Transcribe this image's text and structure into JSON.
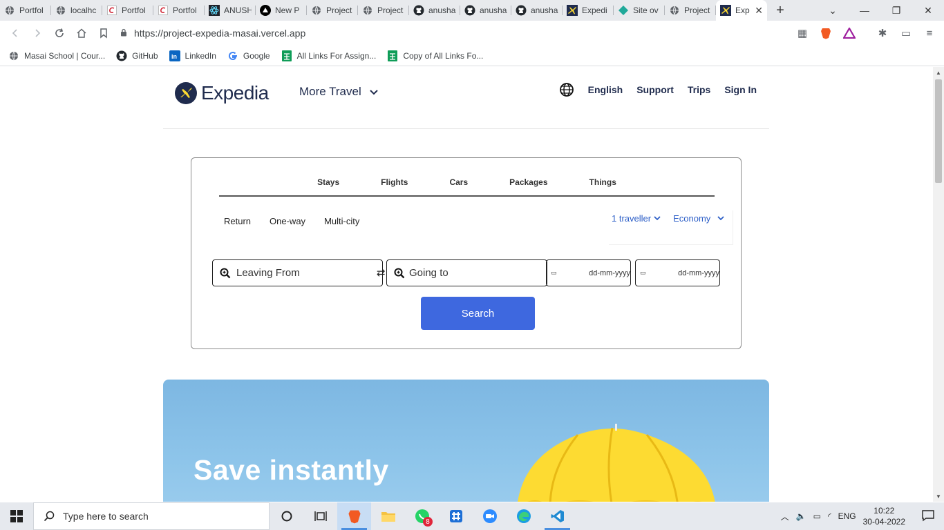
{
  "browser": {
    "tabs": [
      {
        "label": "Portfol",
        "icon": "globe-icon"
      },
      {
        "label": "localhc",
        "icon": "globe-icon"
      },
      {
        "label": "Portfol",
        "icon": "c-logo-icon"
      },
      {
        "label": "Portfol",
        "icon": "c-logo-icon"
      },
      {
        "label": "ANUSH",
        "icon": "react-icon"
      },
      {
        "label": "New P",
        "icon": "vercel-icon"
      },
      {
        "label": "Project",
        "icon": "globe-icon"
      },
      {
        "label": "Project",
        "icon": "globe-icon"
      },
      {
        "label": "anusha",
        "icon": "github-icon"
      },
      {
        "label": "anusha",
        "icon": "github-icon"
      },
      {
        "label": "anusha",
        "icon": "github-icon"
      },
      {
        "label": "Expedi",
        "icon": "expedia-icon"
      },
      {
        "label": "Site ov",
        "icon": "netlify-icon"
      },
      {
        "label": "Project",
        "icon": "globe-icon"
      },
      {
        "label": "Exp",
        "icon": "expedia-icon",
        "active": true
      }
    ],
    "close_tab_glyph": "✕",
    "new_tab_glyph": "+",
    "url": "https://project-expedia-masai.vercel.app",
    "bookmarks": [
      {
        "label": "Masai School | Cour...",
        "icon": "globe-icon"
      },
      {
        "label": "GitHub",
        "icon": "github-icon"
      },
      {
        "label": "LinkedIn",
        "icon": "linkedin-icon"
      },
      {
        "label": "Google",
        "icon": "google-icon"
      },
      {
        "label": "All Links For Assign...",
        "icon": "sheets-icon"
      },
      {
        "label": "Copy of All Links Fo...",
        "icon": "sheets-icon"
      }
    ]
  },
  "header": {
    "logo_text": "Expedia",
    "more_travel": "More Travel",
    "language": "English",
    "support": "Support",
    "trips": "Trips",
    "sign_in": "Sign In"
  },
  "search": {
    "tabs": [
      "Stays",
      "Flights",
      "Cars",
      "Packages",
      "Things"
    ],
    "trip_types": [
      "Return",
      "One-way",
      "Multi-city"
    ],
    "travellers": "1 traveller",
    "cabin_class": "Economy",
    "leaving_from": "Leaving From",
    "going_to": "Going to",
    "date_placeholder_1": "dd-mm-yyyy",
    "date_placeholder_2": "dd-mm-yyyy",
    "swap_glyph": "⇄",
    "search_button": "Search"
  },
  "hero": {
    "title": "Save instantly"
  },
  "taskbar": {
    "search_placeholder": "Type here to search",
    "whatsapp_badge": "8",
    "language": "ENG",
    "time": "10:22",
    "date": "30-04-2022"
  },
  "colors": {
    "brand_navy": "#1f2b4d",
    "brand_yellow": "#fddb32",
    "search_blue": "#3e68df",
    "link_blue": "#2c5ec7"
  }
}
